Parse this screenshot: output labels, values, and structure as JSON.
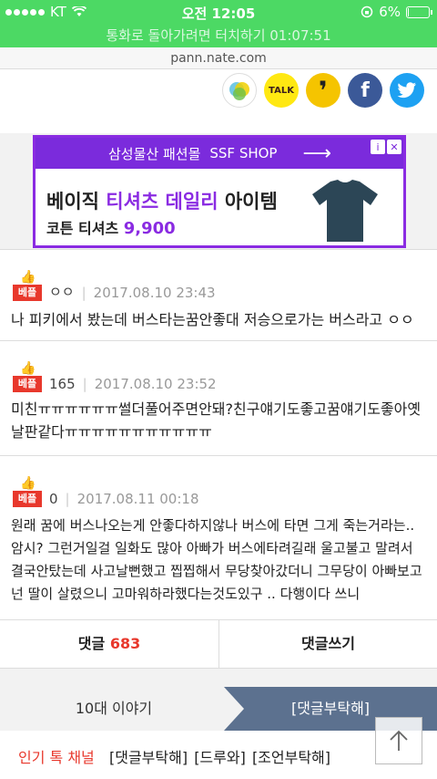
{
  "status_bar": {
    "carrier": "KT",
    "time": "오전 12:05",
    "battery_percent": "6%",
    "battery_level": 0.06,
    "call_banner": "통화로 돌아가려면 터치하기 01:07:51"
  },
  "url": "pann.nate.com",
  "share": {
    "kakaotalk_label": "TALK",
    "kakaostory_label": "❜",
    "facebook_label": "f",
    "twitter_label": "🐦"
  },
  "ad": {
    "brand": "삼성물산 패션몰",
    "shop": "SSF SHOP",
    "info_icon": "i",
    "close_icon": "✕",
    "headline_pre": "베이직",
    "headline_accent": "티셔츠 데일리",
    "headline_post": "아이템",
    "sub_label": "코튼 티셔츠",
    "price": "9,900",
    "shirt_color": "#2c4656"
  },
  "comments": [
    {
      "badge": "베플",
      "votes": "ㅇㅇ",
      "date": "2017.08.10 23:43",
      "text": "나 피키에서 봤는데 버스타는꿈안좋대 저승으로가는 버스라고 ㅇㅇ ..."
    },
    {
      "badge": "베플",
      "votes": "165",
      "date": "2017.08.10 23:52",
      "text": "미친ㅠㅠㅠㅠㅠㅠ썰더풀어주면안돼?친구얘기도좋고꿈얘기도좋아옛날판같다ㅠㅠㅠㅠㅠㅠㅠㅠㅠㅠㅠ"
    },
    {
      "badge": "베플",
      "votes": "0",
      "date": "2017.08.11 00:18",
      "text": "원래 꿈에 버스나오는게 안좋다하지않나 버스에 타면 그게 죽는거라는.. 암시? 그런거일걸 일화도 많아 아빠가 버스에타려길래 울고불고 말려서 결국안탔는데 사고날뻔했고 찝찝해서 무당찾아갔더니 그무당이 아빠보고 넌 딸이 살렸으니 고마워하라했다는것도있구 .. 다행이다 쓰니"
    }
  ],
  "bottom_tabs": {
    "comments_label": "댓글",
    "comments_count": "683",
    "write_label": "댓글쓰기"
  },
  "topics": {
    "left": "10대 이야기",
    "right": "[댓글부탁해]"
  },
  "channel": {
    "title": "인기 톡 채널",
    "items": [
      "[댓글부탁해]",
      "[드루와]",
      "[조언부탁해]"
    ]
  },
  "colors": {
    "status_green": "#4cd964",
    "accent_red": "#e8382c",
    "ad_purple": "#7b2bdc",
    "topic_blue": "#5c718f"
  }
}
